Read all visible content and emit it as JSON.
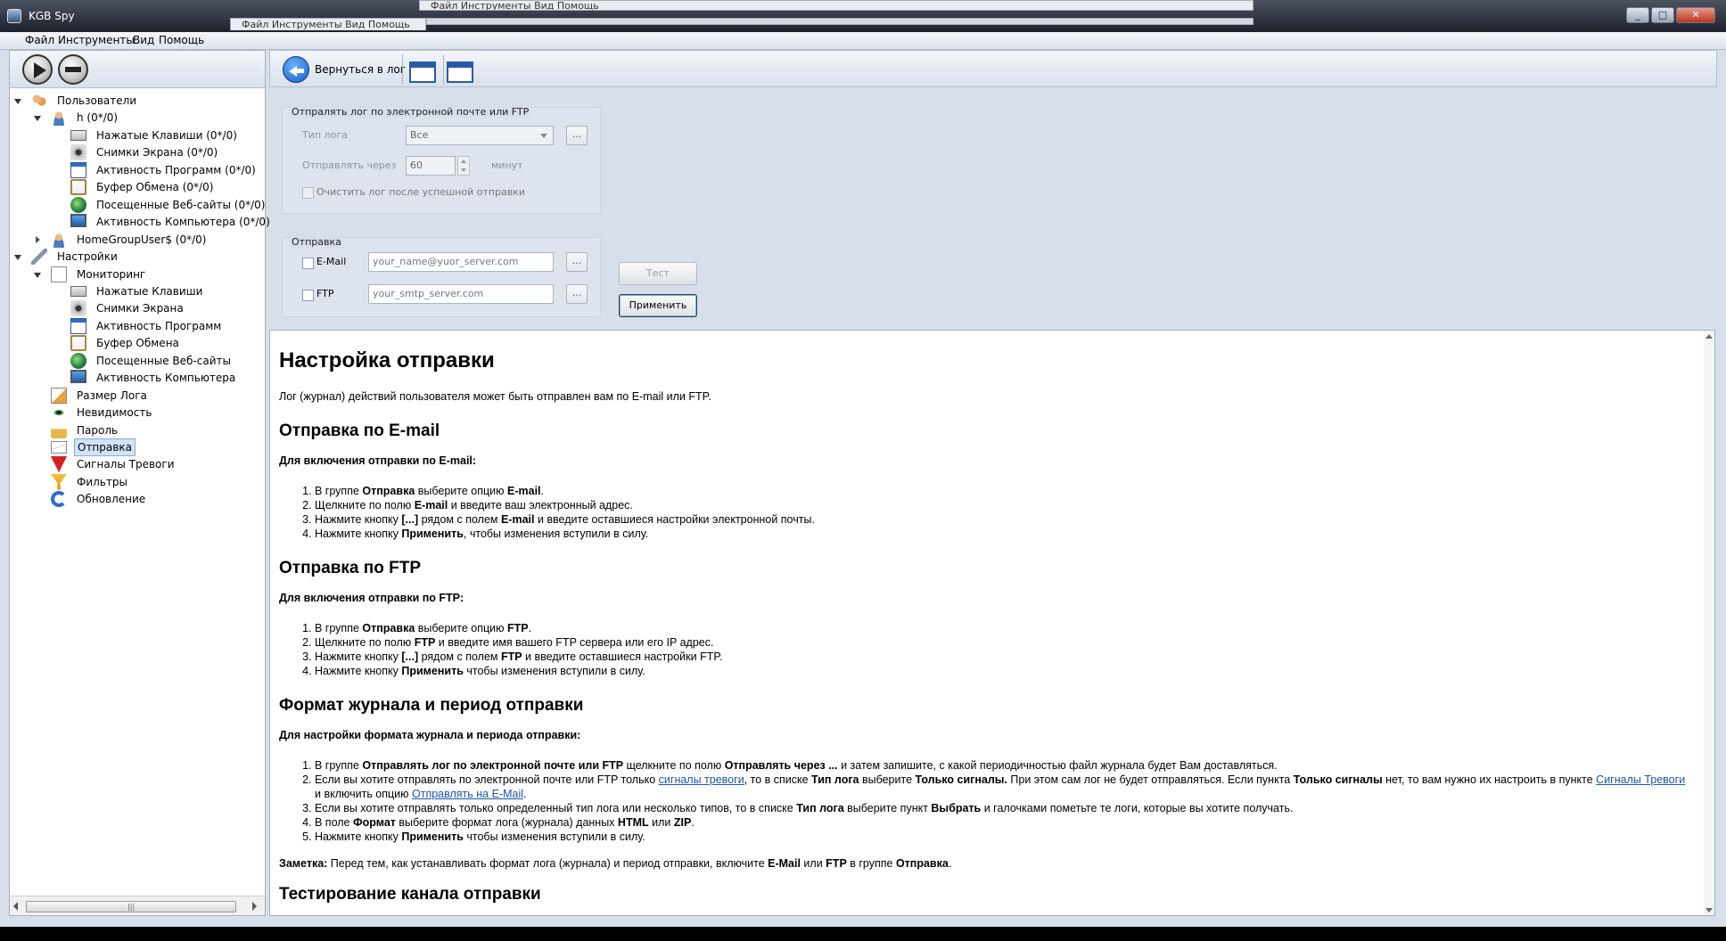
{
  "window": {
    "title": "KGB Spy",
    "ghost_menu": "Файл  Инструменты  Вид  Помощь",
    "caption_buttons": [
      "_",
      "□",
      "✕"
    ]
  },
  "menubar": [
    "Файл",
    "Инструменты",
    "Вид",
    "Помощь"
  ],
  "toolbar": {
    "back_label": "Вернуться в лог"
  },
  "tree": [
    {
      "label": "Пользователи",
      "icon": "users-icon",
      "level": 0,
      "expanded": true
    },
    {
      "label": "h (0*/0)",
      "icon": "user-icon",
      "level": 1,
      "expanded": true
    },
    {
      "label": "Нажатые Клавиши (0*/0)",
      "icon": "keyboard-icon",
      "level": 2
    },
    {
      "label": "Снимки Экрана (0*/0)",
      "icon": "camera-icon",
      "level": 2
    },
    {
      "label": "Активность Программ (0*/0)",
      "icon": "window-icon",
      "level": 2
    },
    {
      "label": "Буфер Обмена (0*/0)",
      "icon": "clipboard-icon",
      "level": 2
    },
    {
      "label": "Посещенные Веб-сайты (0*/0)",
      "icon": "globe-icon",
      "level": 2
    },
    {
      "label": "Активность Компьютера (0*/0)",
      "icon": "monitor-icon",
      "level": 2
    },
    {
      "label": "HomeGroupUser$ (0*/0)",
      "icon": "user-icon",
      "level": 1,
      "expanded": false
    },
    {
      "label": "Настройки",
      "icon": "wrench-icon",
      "level": 0,
      "expanded": true
    },
    {
      "label": "Мониторинг",
      "icon": "document-icon",
      "level": 1,
      "expanded": true
    },
    {
      "label": "Нажатые Клавиши",
      "icon": "keyboard-icon",
      "level": 2
    },
    {
      "label": "Снимки Экрана",
      "icon": "camera-icon",
      "level": 2
    },
    {
      "label": "Активность Программ",
      "icon": "window-icon",
      "level": 2
    },
    {
      "label": "Буфер Обмена",
      "icon": "clipboard-icon",
      "level": 2
    },
    {
      "label": "Посещенные Веб-сайты",
      "icon": "globe-icon",
      "level": 2
    },
    {
      "label": "Активность Компьютера",
      "icon": "monitor-icon",
      "level": 2
    },
    {
      "label": "Размер Лога",
      "icon": "log-size-icon",
      "level": 1
    },
    {
      "label": "Невидимость",
      "icon": "eye-icon",
      "level": 1
    },
    {
      "label": "Пароль",
      "icon": "lock-icon",
      "level": 1
    },
    {
      "label": "Отправка",
      "icon": "envelope-icon",
      "level": 1,
      "selected": true
    },
    {
      "label": "Сигналы Тревоги",
      "icon": "warning-icon",
      "level": 1
    },
    {
      "label": "Фильтры",
      "icon": "filter-icon",
      "level": 1
    },
    {
      "label": "Обновление",
      "icon": "refresh-icon",
      "level": 1
    }
  ],
  "settings": {
    "group1_title": "Отпралять лог по электронной почте или FTP",
    "log_type_label": "Тип лога",
    "log_type_value": "Все",
    "send_every_label": "Отправлять через",
    "send_every_value": "60",
    "minutes_label": "минут",
    "clear_log_label": "Очистить лог после успешной отправки",
    "group2_title": "Отправка",
    "email_label": "E-Mail",
    "email_placeholder": "your_name@yuor_server.com",
    "ftp_label": "FTP",
    "ftp_placeholder": "your_smtp_server.com",
    "dots": "...",
    "test_label": "Тест",
    "apply_label": "Применить"
  },
  "help": {
    "title": "Настройка отправки",
    "intro": "Лог (журнал) действий пользователя может быть отправлен вам по E-mail или FTP.",
    "s1_title": "Отправка по E-mail",
    "s1_lead": "Для включения отправки по E-mail:",
    "s1_items": [
      [
        "В группе ",
        "Отправка",
        " выберите опцию ",
        "E-mail",
        "."
      ],
      [
        "Щелкните по полю ",
        "E-mail",
        " и введите ваш электронный адрес."
      ],
      [
        "Нажмите кнопку ",
        "[...]",
        " рядом с полем ",
        "E-mail",
        " и введите оставшиеся настройки электронной почты."
      ],
      [
        "Нажмите кнопку ",
        "Применить",
        ", чтобы изменения вступили в силу."
      ]
    ],
    "s2_title": "Отправка по FTP",
    "s2_lead": "Для включения отправки по FTP:",
    "s2_items": [
      [
        "В группе ",
        "Отправка",
        " выберите опцию ",
        "FTP",
        "."
      ],
      [
        "Щелкните по полю ",
        "FTP",
        " и введите имя вашего FTP сервера или его IP адрес."
      ],
      [
        "Нажмите кнопку ",
        "[...]",
        " рядом с полем ",
        "FTP",
        " и введите оставшиеся настройки FTP."
      ],
      [
        "Нажмите кнопку ",
        "Применить",
        " чтобы изменения вступили в силу."
      ]
    ],
    "s3_title": "Формат журнала и период отправки",
    "s3_lead": "Для настройки формата журнала и периода отправки:",
    "s3_i1": [
      "В группе ",
      "Отправлять лог по электронной почте или FTP",
      " щелкните по полю ",
      "Отправлять через ...",
      " и затем запишите, с какой периодичностью файл журнала будет Вам доставляться."
    ],
    "s3_i2a": "Если вы хотите отправлять по электронной почте или FTP только ",
    "s3_i2_link1": "сигналы тревоги",
    "s3_i2b": ", то в списке ",
    "s3_i2_b1": "Тип лога",
    "s3_i2c": " выберите ",
    "s3_i2_b2": "Только сигналы.",
    "s3_i2d": " При этом сам лог не будет отправляться. Если пункта ",
    "s3_i2_b3": "Только сигналы",
    "s3_i2e": " нет, то вам нужно их настроить в пункте ",
    "s3_i2_link2": "Сигналы Тревоги",
    "s3_i2f": " и включить опцию ",
    "s3_i2_link3": "Отправлять на E-Mail",
    "s3_i2g": ".",
    "s3_i3": [
      "Если вы хотите отправлять только определенный тип лога или несколько типов, то в списке ",
      "Тип лога",
      " выберите пункт ",
      "Выбрать",
      " и галочками пометьте те логи, которые вы хотите получать."
    ],
    "s3_i4": [
      "В поле ",
      "Формат",
      " выберите формат лога (журнала) данных ",
      "HTML",
      " или ",
      "ZIP",
      "."
    ],
    "s3_i5": [
      "Нажмите кнопку ",
      "Применить",
      " чтобы изменения вступили в силу."
    ],
    "note_b": "Заметка:",
    "note_a": " Перед тем, как устанавливать формат лога (журнала) и период отправки, включите ",
    "note_b2": "E-Mail",
    "note_c": " или ",
    "note_b3": "FTP",
    "note_d": " в группе ",
    "note_b4": "Отправка",
    "note_e": ".",
    "s4_title": "Тестирование канала отправки"
  }
}
